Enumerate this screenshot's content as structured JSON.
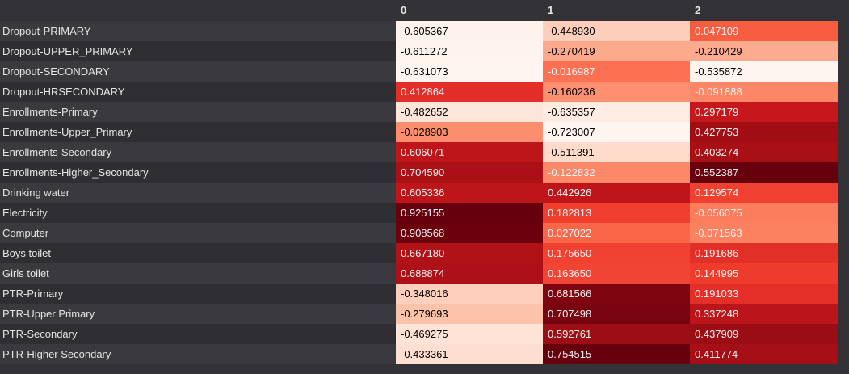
{
  "chart_data": {
    "type": "heatmap",
    "columns": [
      "0",
      "1",
      "2"
    ],
    "rows": [
      {
        "label": "Dropout-PRIMARY",
        "values": [
          "-0.605367",
          "-0.448930",
          "0.047109"
        ]
      },
      {
        "label": "Dropout-UPPER_PRIMARY",
        "values": [
          "-0.611272",
          "-0.270419",
          "-0.210429"
        ]
      },
      {
        "label": "Dropout-SECONDARY",
        "values": [
          "-0.631073",
          "-0.016987",
          "-0.535872"
        ]
      },
      {
        "label": "Dropout-HRSECONDARY",
        "values": [
          "0.412864",
          "-0.160236",
          "-0.091888"
        ]
      },
      {
        "label": "Enrollments-Primary",
        "values": [
          "-0.482652",
          "-0.635357",
          "0.297179"
        ]
      },
      {
        "label": "Enrollments-Upper_Primary",
        "values": [
          "-0.028903",
          "-0.723007",
          "0.427753"
        ]
      },
      {
        "label": "Enrollments-Secondary",
        "values": [
          "0.606071",
          "-0.511391",
          "0.403274"
        ]
      },
      {
        "label": "Enrollments-Higher_Secondary",
        "values": [
          "0.704590",
          "-0.122832",
          "0.552387"
        ]
      },
      {
        "label": "Drinking water",
        "values": [
          "0.605336",
          "0.442926",
          "0.129574"
        ]
      },
      {
        "label": "Electricity",
        "values": [
          "0.925155",
          "0.182813",
          "-0.056075"
        ]
      },
      {
        "label": "Computer",
        "values": [
          "0.908568",
          "0.027022",
          "-0.071563"
        ]
      },
      {
        "label": "Boys toilet",
        "values": [
          "0.667180",
          "0.175650",
          "0.191686"
        ]
      },
      {
        "label": "Girls toilet",
        "values": [
          "0.688874",
          "0.163650",
          "0.144995"
        ]
      },
      {
        "label": "PTR-Primary",
        "values": [
          "-0.348016",
          "0.681566",
          "0.191033"
        ]
      },
      {
        "label": "PTR-Upper Primary",
        "values": [
          "-0.279693",
          "0.707498",
          "0.337248"
        ]
      },
      {
        "label": "PTR-Secondary",
        "values": [
          "-0.469275",
          "0.592761",
          "0.437909"
        ]
      },
      {
        "label": "PTR-Higher Secondary",
        "values": [
          "-0.433361",
          "0.754515",
          "0.411774"
        ]
      }
    ],
    "colormap": "Reds",
    "column_color_ranges": [
      [
        -0.631073,
        0.925155
      ],
      [
        -0.723007,
        0.754515
      ],
      [
        -0.535872,
        0.552387
      ]
    ]
  }
}
